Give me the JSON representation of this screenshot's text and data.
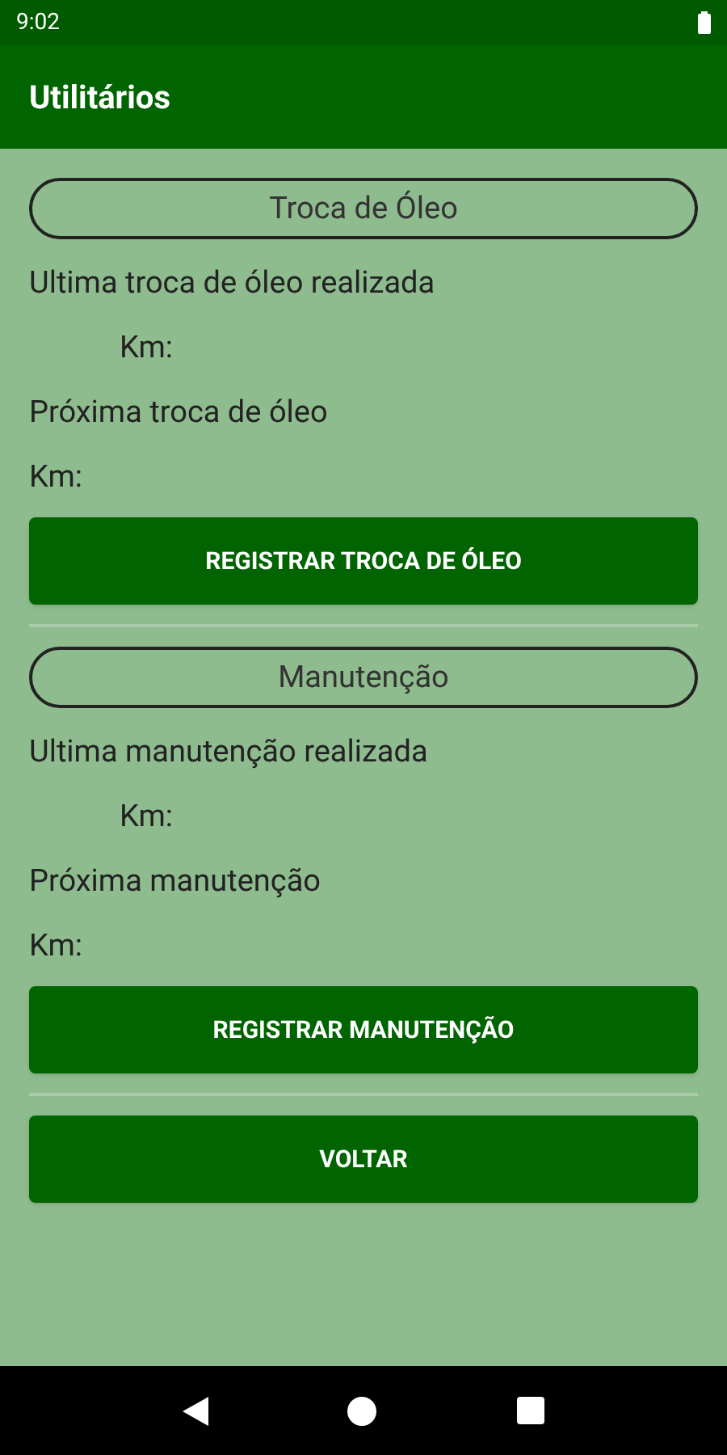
{
  "status_bar": {
    "time": "9:02"
  },
  "app_bar": {
    "title": "Utilitários"
  },
  "sections": [
    {
      "title": "Troca de Óleo",
      "last_label": "Ultima troca de óleo realizada",
      "last_km": "Km:",
      "next_label": "Próxima troca de óleo",
      "next_km": "Km:",
      "button": "REGISTRAR TROCA DE ÓLEO"
    },
    {
      "title": "Manutenção",
      "last_label": "Ultima manutenção realizada",
      "last_km": "Km:",
      "next_label": "Próxima manutenção",
      "next_km": "Km:",
      "button": "REGISTRAR MANUTENÇÃO"
    }
  ],
  "back_button": "VOLTAR"
}
